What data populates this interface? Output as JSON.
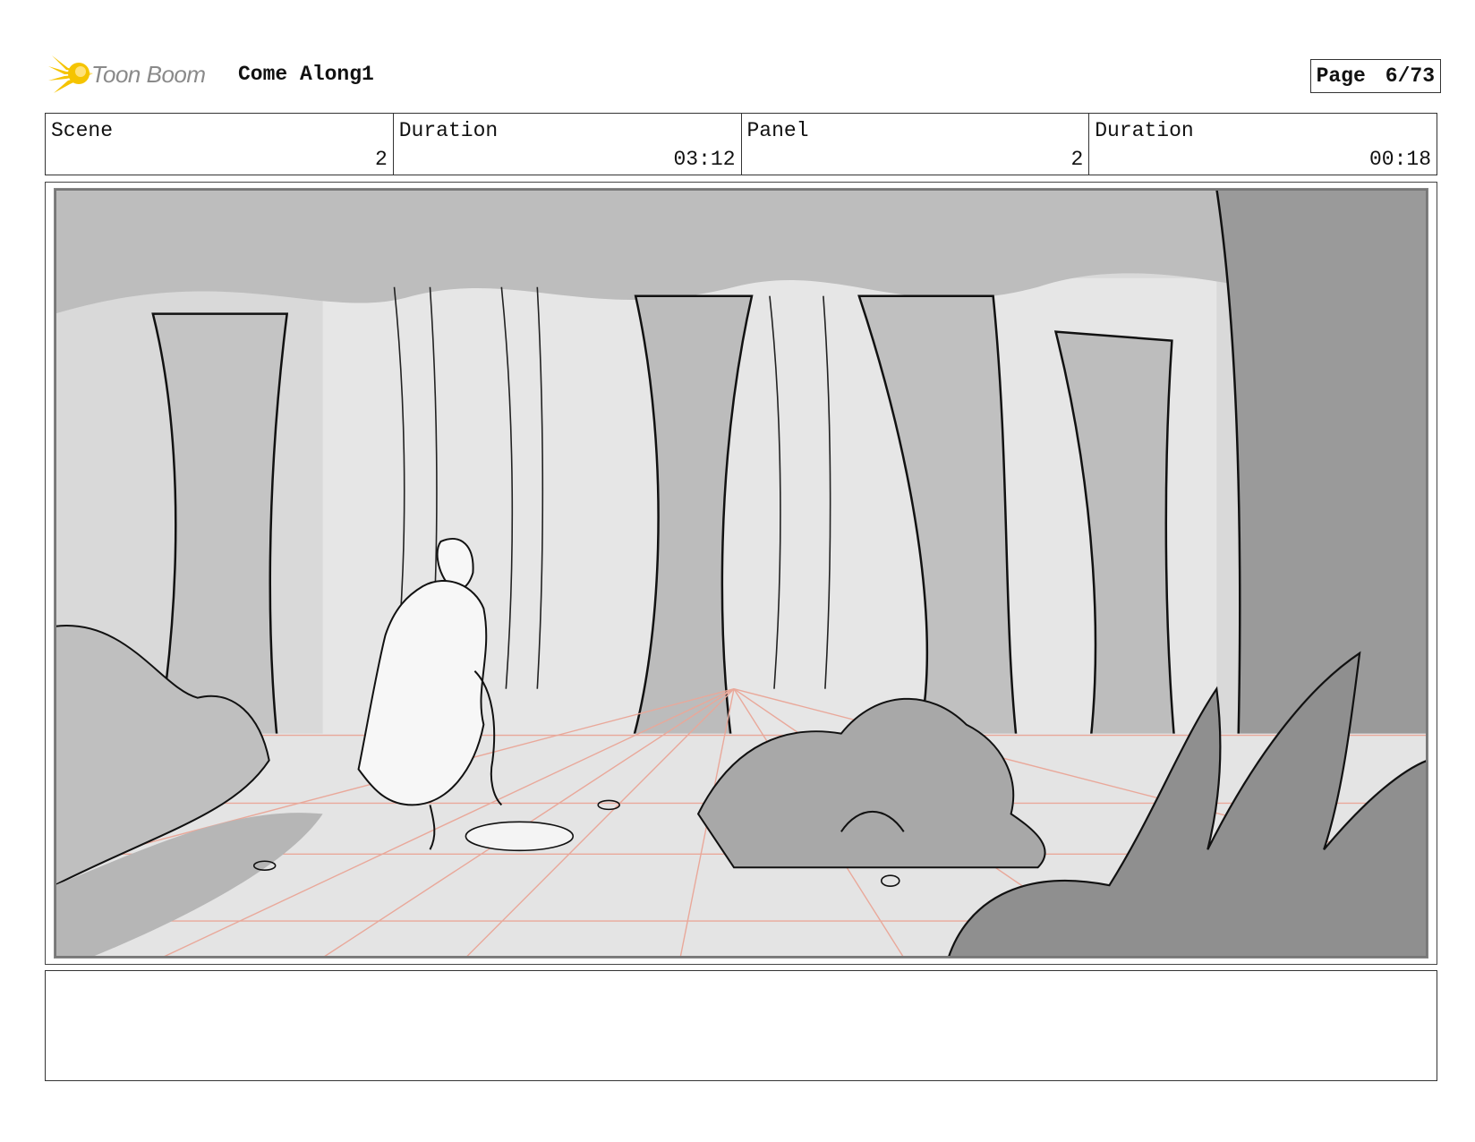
{
  "header": {
    "logo_text": "Toon Boom",
    "project_title": "Come Along1",
    "page_label": "Page",
    "page_value": "6/73"
  },
  "info": {
    "scene_label": "Scene",
    "scene_value": "2",
    "scene_duration_label": "Duration",
    "scene_duration_value": "03:12",
    "panel_label": "Panel",
    "panel_value": "2",
    "panel_duration_label": "Duration",
    "panel_duration_value": "00:18"
  },
  "colors": {
    "logo_yellow": "#f5c400",
    "perspective_grid": "#e9a89a"
  }
}
